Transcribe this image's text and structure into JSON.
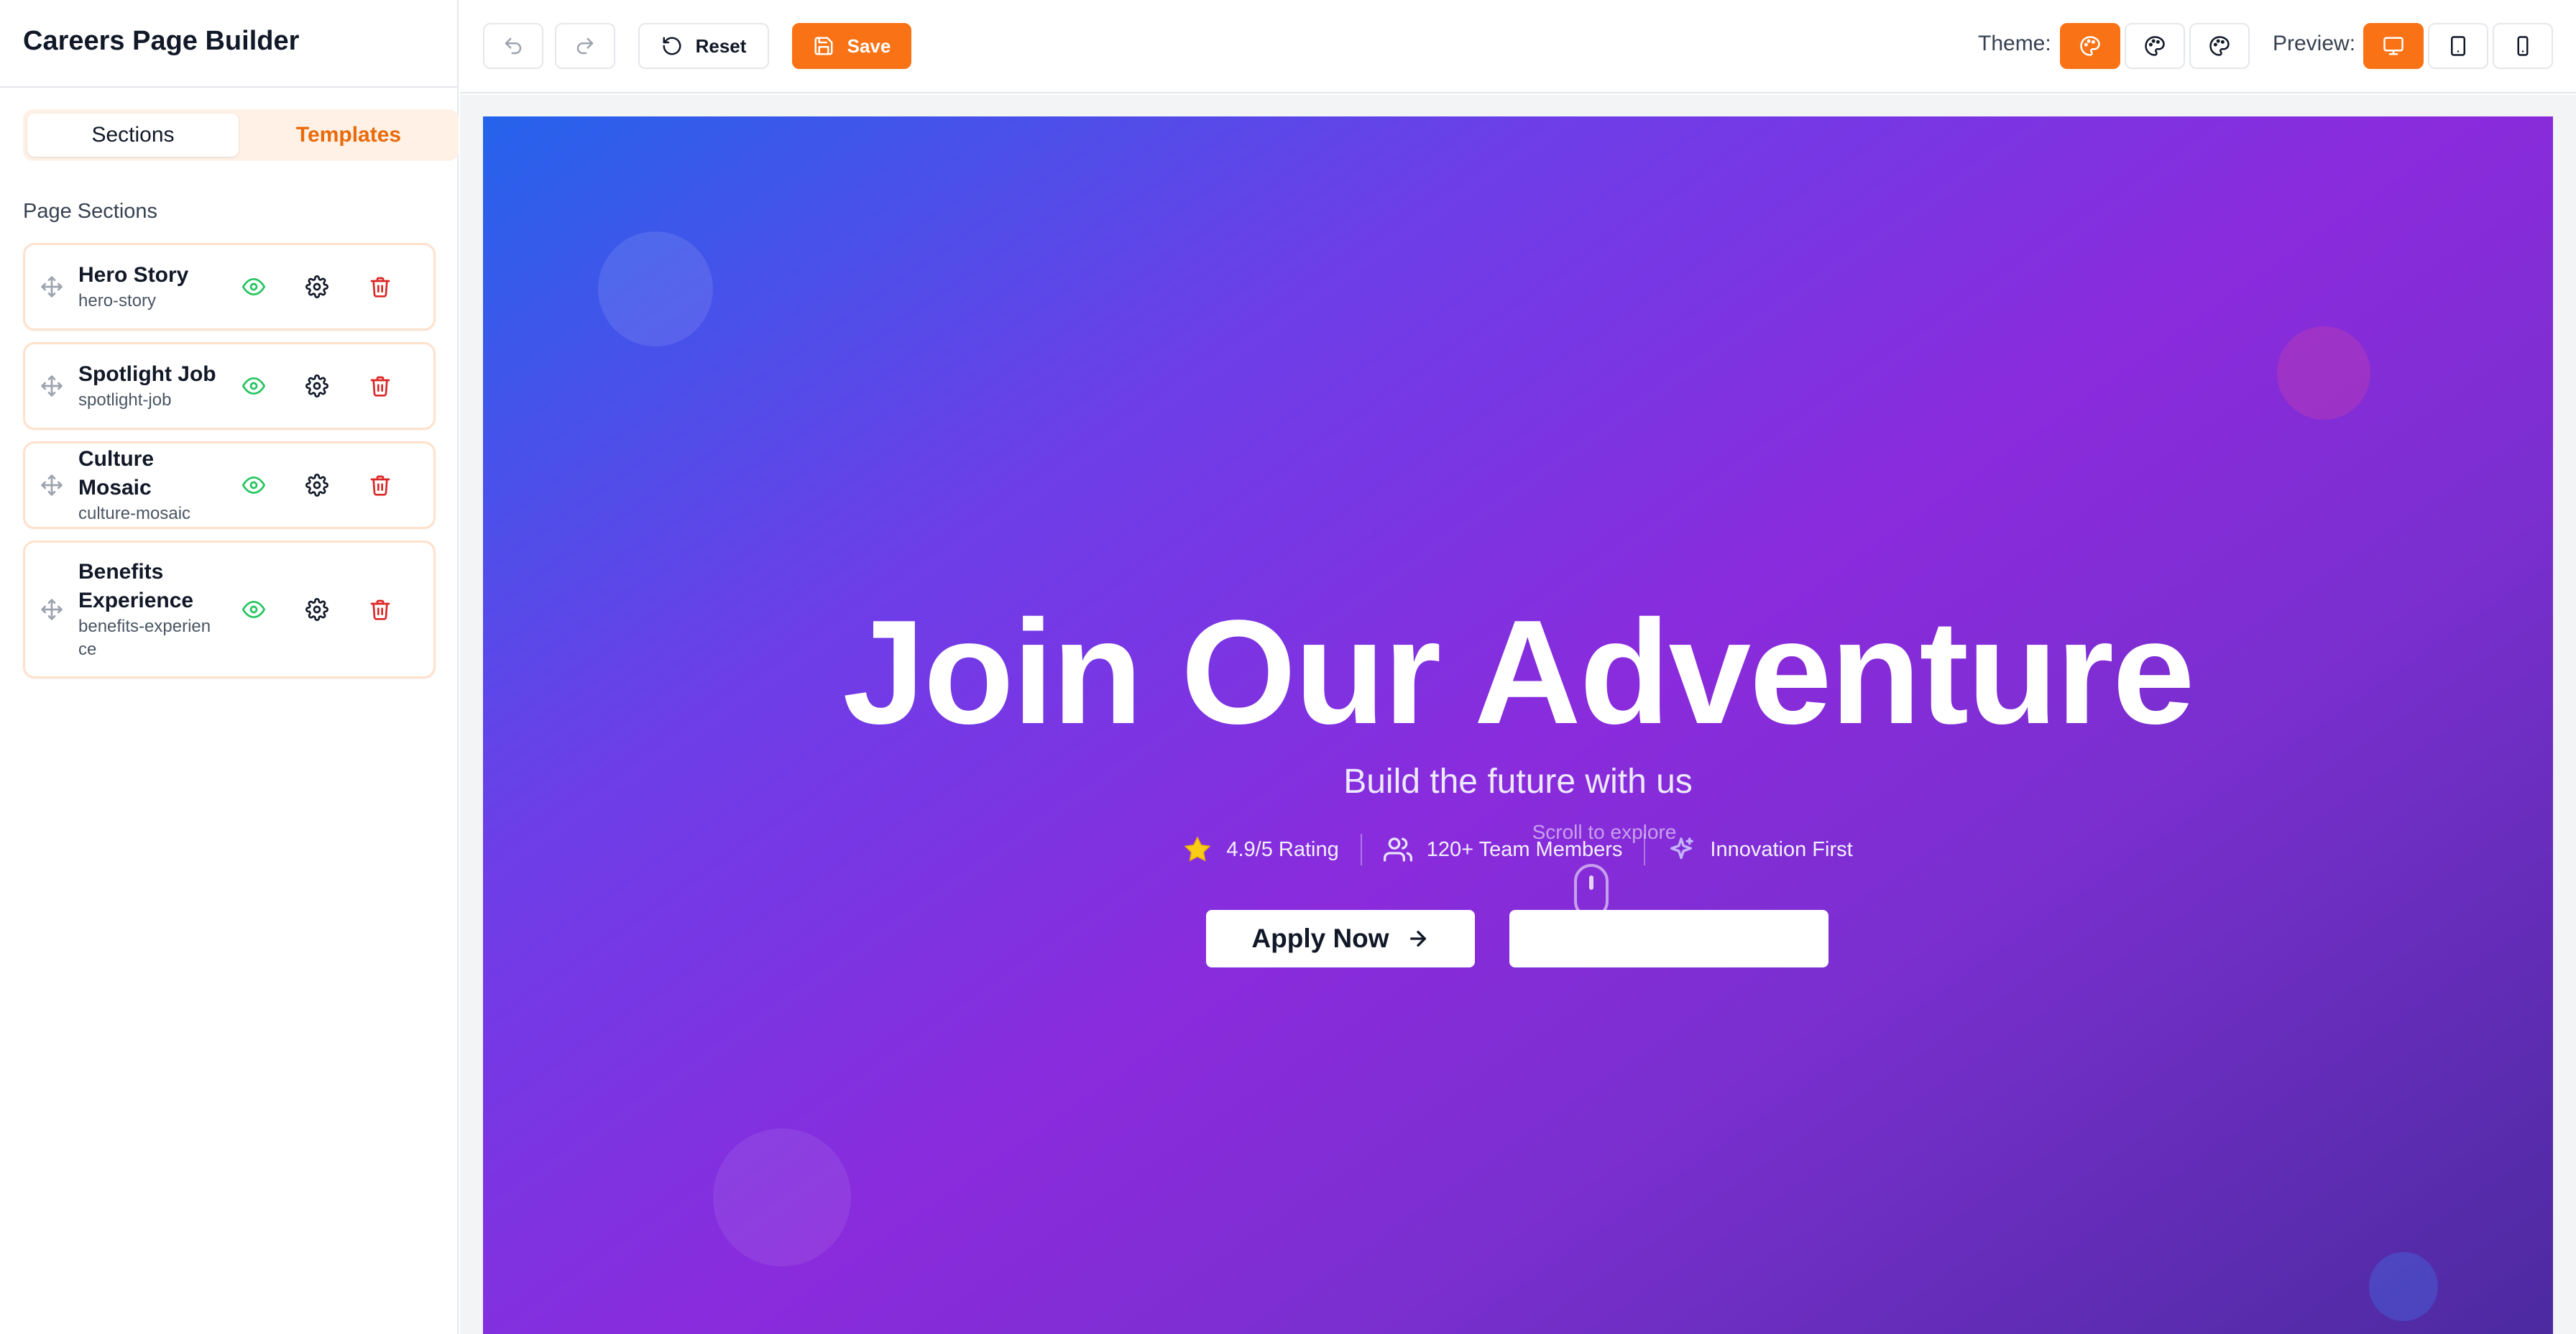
{
  "app": {
    "title": "Careers Page Builder"
  },
  "sidebar": {
    "tabs": [
      {
        "label": "Sections",
        "active": true
      },
      {
        "label": "Templates",
        "active": false
      }
    ],
    "heading": "Page Sections",
    "sections": [
      {
        "name": "Hero Story",
        "slug": "hero-story"
      },
      {
        "name": "Spotlight Job",
        "slug": "spotlight-job"
      },
      {
        "name": "Culture Mosaic",
        "slug": "culture-mosaic"
      },
      {
        "name": "Benefits Experience",
        "slug": "benefits-experience"
      }
    ]
  },
  "toolbar": {
    "reset_label": "Reset",
    "save_label": "Save",
    "theme_label": "Theme:",
    "preview_label": "Preview:"
  },
  "hero": {
    "title": "Join Our Adventure",
    "subtitle": "Build the future with us",
    "stats": [
      {
        "icon": "star-icon",
        "text": "4.9/5 Rating"
      },
      {
        "icon": "users-icon",
        "text": "120+ Team Members"
      },
      {
        "icon": "sparkles-icon",
        "text": "Innovation First"
      }
    ],
    "scroll_hint": "Scroll to explore",
    "primary_cta": "Apply Now",
    "secondary_cta": ""
  },
  "colors": {
    "accent": "#f97316",
    "success": "#22c55e",
    "danger": "#dc2626",
    "hero_gradient_start": "#2563eb",
    "hero_gradient_mid": "#8a2bdc",
    "hero_gradient_end": "#4c2aa0"
  }
}
